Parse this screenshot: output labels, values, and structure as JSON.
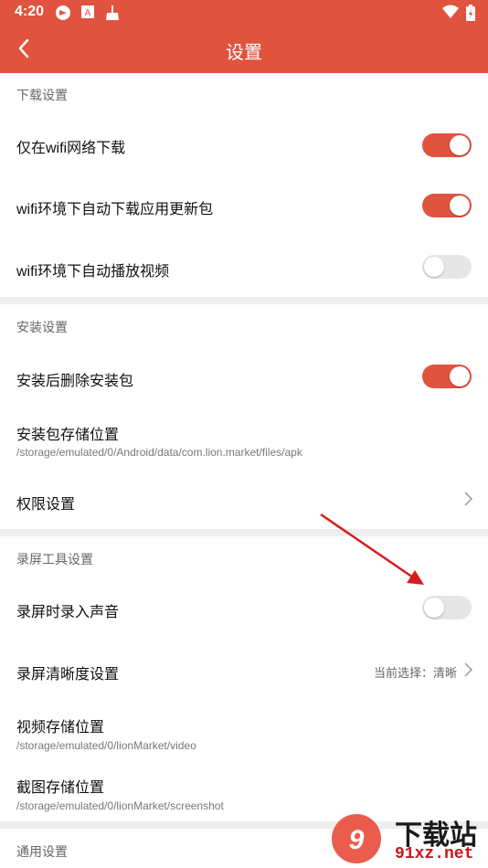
{
  "status_bar": {
    "time": "4:20"
  },
  "app_bar": {
    "title": "设置",
    "back_label": ""
  },
  "sections": [
    {
      "header": "下载设置"
    },
    {
      "header": "安装设置"
    },
    {
      "header": "录屏工具设置"
    },
    {
      "header": "通用设置"
    }
  ],
  "rows": {
    "wifi_only": {
      "label": "仅在wifi网络下载",
      "toggle": "on"
    },
    "wifi_update": {
      "label": "wifi环境下自动下载应用更新包",
      "toggle": "on"
    },
    "wifi_video": {
      "label": "wifi环境下自动播放视频",
      "toggle": "off"
    },
    "delete_pkg": {
      "label": "安装后删除安装包",
      "toggle": "on"
    },
    "pkg_location": {
      "label": "安装包存储位置",
      "path": "/storage/emulated/0/Android/data/com.lion.market/files/apk"
    },
    "permissions": {
      "label": "权限设置"
    },
    "record_audio": {
      "label": "录屏时录入声音",
      "toggle": "off"
    },
    "record_quality": {
      "label": "录屏清晰度设置",
      "current": "当前选择：清晰"
    },
    "video_location": {
      "label": "视频存储位置",
      "path": "/storage/emulated/0/lionMarket/video"
    },
    "screenshot_location": {
      "label": "截图存储位置",
      "path": "/storage/emulated/0/lionMarket/screenshot"
    }
  },
  "watermark": {
    "text": "下载站",
    "domain": "91xz.net"
  },
  "colors": {
    "accent": "#e0533e",
    "toggle_off": "#e6e6e6",
    "section_bg": "#eeeeee",
    "annotation_arrow": "#d71c1c"
  },
  "icons": [
    "navigation-icon",
    "android-icon",
    "cleaner-icon",
    "wifi-icon",
    "battery-icon",
    "back-arrow-icon",
    "chevron-right-icon"
  ]
}
